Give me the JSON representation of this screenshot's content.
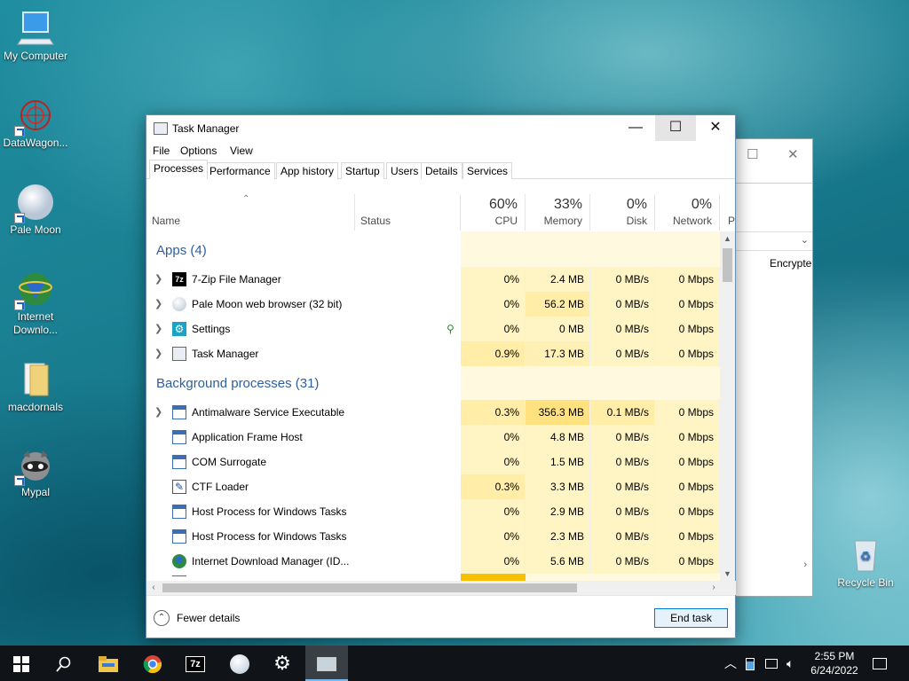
{
  "desktop": {
    "icons": [
      {
        "label": "My Computer"
      },
      {
        "label": "DataWagon..."
      },
      {
        "label": "Pale Moon"
      },
      {
        "label": "Internet Downlo..."
      },
      {
        "label": "macdornals"
      },
      {
        "label": "Mypal"
      },
      {
        "label": "Recycle Bin"
      }
    ]
  },
  "bg_window": {
    "column_text": "Encrypte"
  },
  "task_manager": {
    "title": "Task Manager",
    "menu": [
      "File",
      "Options",
      "View"
    ],
    "tabs": [
      "Processes",
      "Performance",
      "App history",
      "Startup",
      "Users",
      "Details",
      "Services"
    ],
    "columns": {
      "name": "Name",
      "status": "Status",
      "cpu": {
        "pct": "60%",
        "label": "CPU"
      },
      "memory": {
        "pct": "33%",
        "label": "Memory"
      },
      "disk": {
        "pct": "0%",
        "label": "Disk"
      },
      "network": {
        "pct": "0%",
        "label": "Network"
      },
      "partial": "P"
    },
    "sections": {
      "apps": "Apps (4)",
      "background": "Background processes (31)"
    },
    "apps": [
      {
        "name": "7-Zip File Manager",
        "cpu": "0%",
        "mem": "2.4 MB",
        "disk": "0 MB/s",
        "net": "0 Mbps"
      },
      {
        "name": "Pale Moon web browser (32 bit)",
        "cpu": "0%",
        "mem": "56.2 MB",
        "disk": "0 MB/s",
        "net": "0 Mbps"
      },
      {
        "name": "Settings",
        "cpu": "0%",
        "mem": "0 MB",
        "disk": "0 MB/s",
        "net": "0 Mbps"
      },
      {
        "name": "Task Manager",
        "cpu": "0.9%",
        "mem": "17.3 MB",
        "disk": "0 MB/s",
        "net": "0 Mbps"
      }
    ],
    "background": [
      {
        "name": "Antimalware Service Executable",
        "cpu": "0.3%",
        "mem": "356.3 MB",
        "disk": "0.1 MB/s",
        "net": "0 Mbps"
      },
      {
        "name": "Application Frame Host",
        "cpu": "0%",
        "mem": "4.8 MB",
        "disk": "0 MB/s",
        "net": "0 Mbps"
      },
      {
        "name": "COM Surrogate",
        "cpu": "0%",
        "mem": "1.5 MB",
        "disk": "0 MB/s",
        "net": "0 Mbps"
      },
      {
        "name": "CTF Loader",
        "cpu": "0.3%",
        "mem": "3.3 MB",
        "disk": "0 MB/s",
        "net": "0 Mbps"
      },
      {
        "name": "Host Process for Windows Tasks",
        "cpu": "0%",
        "mem": "2.9 MB",
        "disk": "0 MB/s",
        "net": "0 Mbps"
      },
      {
        "name": "Host Process for Windows Tasks",
        "cpu": "0%",
        "mem": "2.3 MB",
        "disk": "0 MB/s",
        "net": "0 Mbps"
      },
      {
        "name": "Internet Download Manager (ID...",
        "cpu": "0%",
        "mem": "5.6 MB",
        "disk": "0 MB/s",
        "net": "0 Mbps"
      }
    ],
    "footer": {
      "fewer_details": "Fewer details",
      "end_task": "End task"
    }
  },
  "taskbar": {
    "pinned": [
      "start-icon",
      "search-icon",
      "file-explorer-icon",
      "chrome-icon",
      "7zip-icon",
      "pale-moon-icon",
      "settings-icon",
      "task-manager-icon"
    ],
    "clock_time": "2:55 PM",
    "clock_date": "6/24/2022"
  },
  "colors": {
    "heat_light": "#fff4c4",
    "heat_mid": "#ffe79a",
    "heat_strong": "#f8c100",
    "accent": "#0078d7",
    "section_blue": "#2d5f9e"
  }
}
